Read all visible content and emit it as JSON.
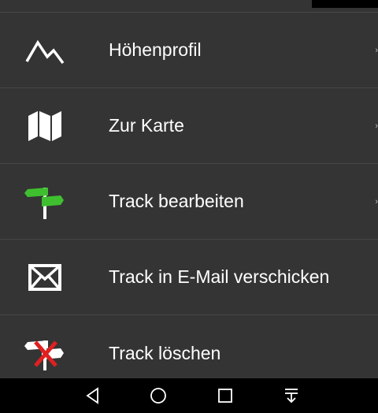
{
  "menu": {
    "items": [
      {
        "label": "Höhenprofil",
        "icon": "mountain-icon",
        "has_chevron": true
      },
      {
        "label": "Zur Karte",
        "icon": "map-icon",
        "has_chevron": true
      },
      {
        "label": "Track bearbeiten",
        "icon": "signpost-edit-icon",
        "has_chevron": true
      },
      {
        "label": "Track in E-Mail verschicken",
        "icon": "envelope-icon",
        "has_chevron": false
      },
      {
        "label": "Track löschen",
        "icon": "signpost-delete-icon",
        "has_chevron": false
      }
    ],
    "chevron": "›"
  },
  "navbar": {
    "buttons": [
      "back-icon",
      "home-icon",
      "recents-icon",
      "notifications-pull-icon"
    ]
  },
  "colors": {
    "background": "#343434",
    "divider": "#474747",
    "text": "#ffffff",
    "green_accent": "#3fbf2f",
    "red_accent": "#e02020"
  }
}
